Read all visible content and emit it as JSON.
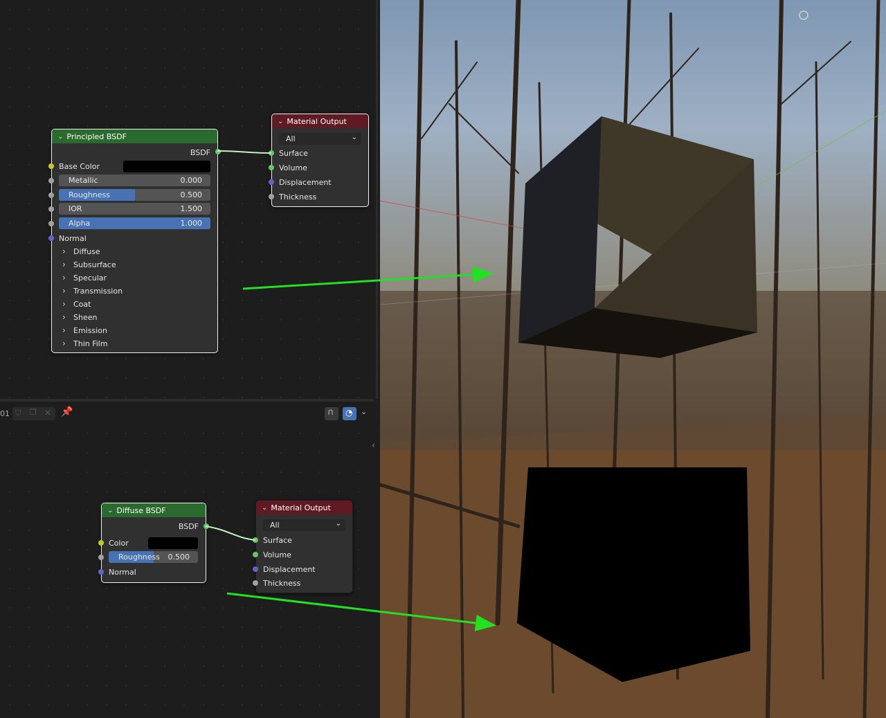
{
  "top_editor": {
    "principled": {
      "title": "Principled BSDF",
      "output": "BSDF",
      "base_color_label": "Base Color",
      "fields": [
        {
          "label": "Metallic",
          "value": "0.000",
          "fill": 0.0
        },
        {
          "label": "Roughness",
          "value": "0.500",
          "fill": 0.5
        },
        {
          "label": "IOR",
          "value": "1.500",
          "fill": 0.0
        },
        {
          "label": "Alpha",
          "value": "1.000",
          "fill": 1.0
        }
      ],
      "normal_label": "Normal",
      "panels": [
        "Diffuse",
        "Subsurface",
        "Specular",
        "Transmission",
        "Coat",
        "Sheen",
        "Emission",
        "Thin Film"
      ]
    },
    "material_output": {
      "title": "Material Output",
      "target": "All",
      "inputs": [
        "Surface",
        "Volume",
        "Displacement",
        "Thickness"
      ]
    }
  },
  "header": {
    "slot_text": "01"
  },
  "bottom_editor": {
    "diffuse": {
      "title": "Diffuse BSDF",
      "output": "BSDF",
      "color_label": "Color",
      "roughness_label": "Roughness",
      "roughness_value": "0.500",
      "roughness_fill": 0.5,
      "normal_label": "Normal"
    },
    "material_output": {
      "title": "Material Output",
      "target": "All",
      "inputs": [
        "Surface",
        "Volume",
        "Displacement",
        "Thickness"
      ]
    }
  },
  "colors": {
    "shader_header": "#2b6a2f",
    "output_header": "#5f1a24",
    "annotation_arrow": "#22e022",
    "field_accent": "#4772b3"
  }
}
